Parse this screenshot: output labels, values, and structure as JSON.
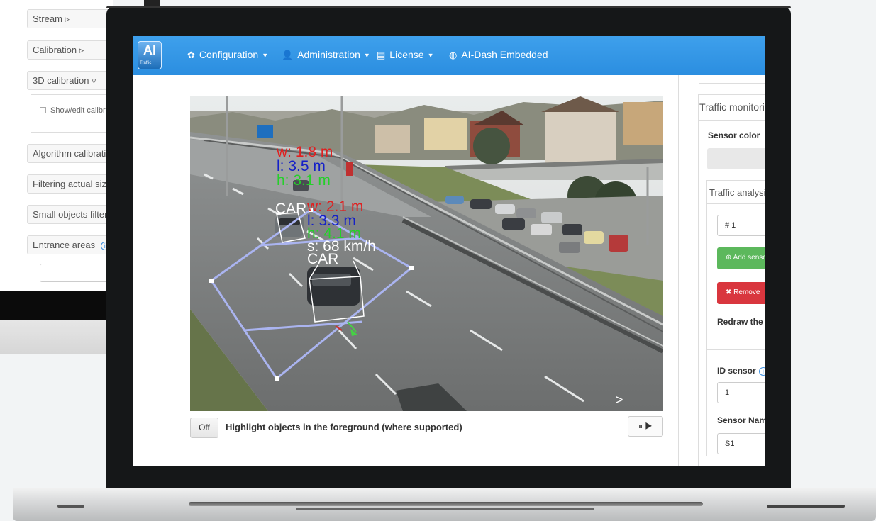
{
  "background_panel": {
    "items": [
      "Stream",
      "Calibration",
      "3D calibration",
      "Algorithm calibration",
      "Filtering actual size",
      "Small objects filter",
      "Entrance areas"
    ],
    "checkbox_label": "Show/edit calibration"
  },
  "navbar": {
    "logo_text": "AI",
    "logo_sub": "Traffic",
    "menu": [
      {
        "label": "Configuration",
        "icon": "gear-icon"
      },
      {
        "label": "Administration",
        "icon": "user-icon"
      },
      {
        "label": "License",
        "icon": "license-icon"
      },
      {
        "label": "AI-Dash Embedded",
        "icon": "dash-icon"
      }
    ]
  },
  "video": {
    "overlay": {
      "car1_w": "w: 1.8 m",
      "car1_l": "l: 3.5 m",
      "car1_h": "h: 3.1 m",
      "car2_class": "CAR",
      "car2_w": "w: 2.1 m",
      "car2_l": "l: 3.3 m",
      "car2_h": "h: 4.1 m",
      "car2_s": "s: 68 km/h",
      "car3_class": "CAR"
    },
    "toggle_label": "Off",
    "highlight_label": "Highlight objects in the foreground (where supported)",
    "pause_play": "⏸ ▶",
    "next_arrow": ">"
  },
  "right_panel": {
    "title": "Traffic monitoring",
    "sensor_color_label": "Sensor color",
    "traffic_analysis_title": "Traffic analysis",
    "sensor_select_value": "# 1",
    "add_sensor_button": "Add sensor",
    "remove_button": "Remove",
    "redraw_label": "Redraw the sensor",
    "id_sensor_label": "ID sensor",
    "id_sensor_value": "1",
    "sensor_name_label": "Sensor Name",
    "sensor_name_value": "S1"
  },
  "colors": {
    "navbar": "#2b8ee0",
    "add_button": "#5cb85c",
    "remove_button": "#d9363e",
    "width_label": "#e02020",
    "length_label": "#1520c8",
    "height_label": "#25d02a"
  }
}
